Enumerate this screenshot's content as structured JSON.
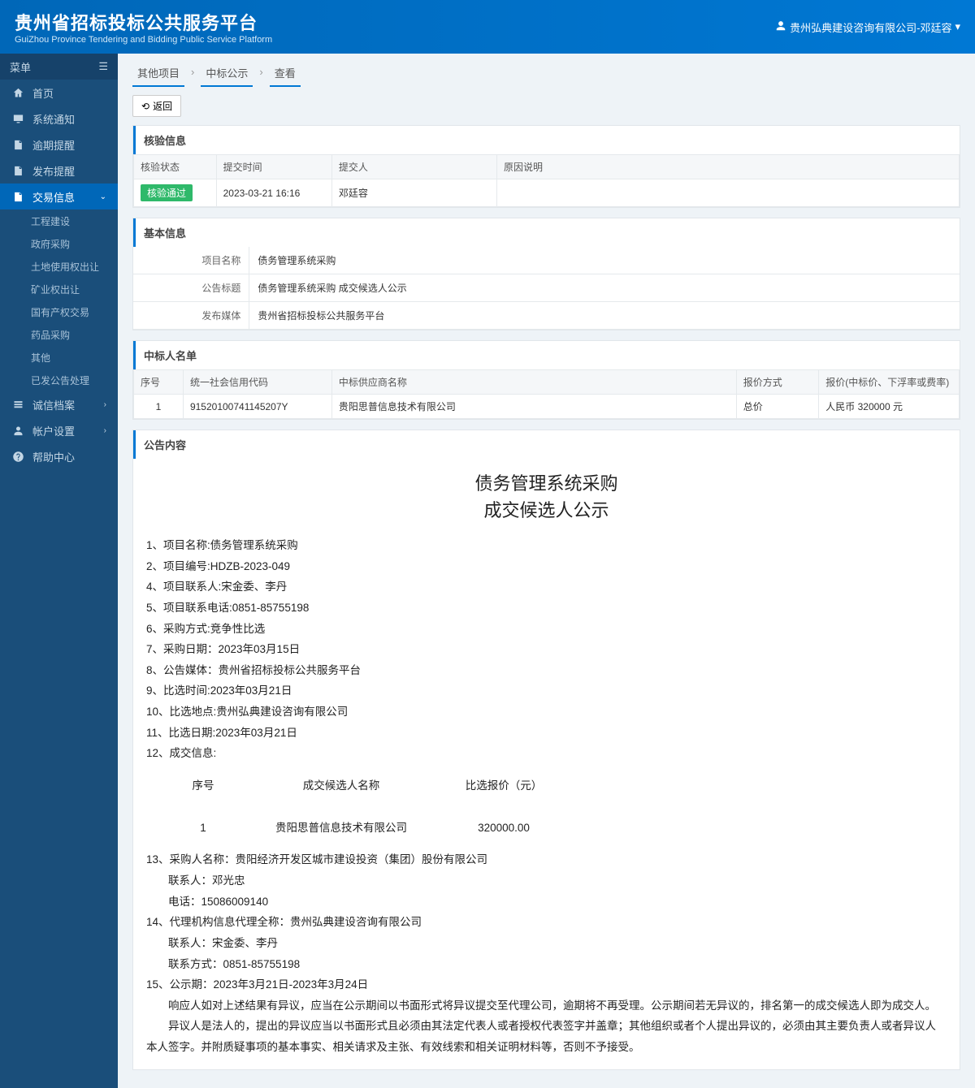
{
  "header": {
    "title_cn": "贵州省招标投标公共服务平台",
    "title_en": "GuiZhou Province Tendering and Bidding Public Service Platform",
    "user": "贵州弘典建设咨询有限公司-邓廷容"
  },
  "sidebar": {
    "menu_label": "菜单",
    "items": [
      {
        "label": "首页",
        "icon": "home"
      },
      {
        "label": "系统通知",
        "icon": "monitor"
      },
      {
        "label": "逾期提醒",
        "icon": "doc"
      },
      {
        "label": "发布提醒",
        "icon": "doc"
      },
      {
        "label": "交易信息",
        "icon": "doc",
        "active": true,
        "expand": true
      },
      {
        "label": "诚信档案",
        "icon": "list",
        "caret": true
      },
      {
        "label": "帐户设置",
        "icon": "user",
        "caret": true
      },
      {
        "label": "帮助中心",
        "icon": "help"
      }
    ],
    "sub_items": [
      "工程建设",
      "政府采购",
      "土地使用权出让",
      "矿业权出让",
      "国有产权交易",
      "药品采购",
      "其他",
      "已发公告处理"
    ]
  },
  "breadcrumb": {
    "a": "其他项目",
    "b": "中标公示",
    "c": "查看"
  },
  "back": "返回",
  "sections": {
    "verify": "核验信息",
    "basic": "基本信息",
    "winner": "中标人名单",
    "notice": "公告内容"
  },
  "verify_table": {
    "headers": [
      "核验状态",
      "提交时间",
      "提交人",
      "原因说明"
    ],
    "status": "核验通过",
    "submit_time": "2023-03-21 16:16",
    "submitter": "邓廷容",
    "reason": ""
  },
  "basic_info": [
    {
      "label": "项目名称",
      "value": "债务管理系统采购"
    },
    {
      "label": "公告标题",
      "value": "债务管理系统采购 成交候选人公示"
    },
    {
      "label": "发布媒体",
      "value": "贵州省招标投标公共服务平台"
    }
  ],
  "winner_table": {
    "headers": [
      "序号",
      "统一社会信用代码",
      "中标供应商名称",
      "报价方式",
      "报价(中标价、下浮率或费率)"
    ],
    "rows": [
      {
        "no": "1",
        "code": "91520100741145207Y",
        "name": "贵阳思普信息技术有限公司",
        "method": "总价",
        "price": "人民币 320000 元"
      }
    ]
  },
  "notice": {
    "title_l1": "债务管理系统采购",
    "title_l2": "成交候选人公示",
    "lines": [
      "1、项目名称:债务管理系统采购",
      "2、项目编号:HDZB-2023-049",
      "4、项目联系人:宋金委、李丹",
      "5、项目联系电话:0851-85755198",
      "6、采购方式:竞争性比选",
      "7、采购日期：2023年03月15日",
      "8、公告媒体：贵州省招标投标公共服务平台",
      "9、比选时间:2023年03月21日",
      "10、比选地点:贵州弘典建设咨询有限公司",
      "11、比选日期:2023年03月21日",
      "12、成交信息:"
    ],
    "candidate_headers": [
      "序号",
      "成交候选人名称",
      "比选报价（元）"
    ],
    "candidates": [
      {
        "no": "1",
        "name": "贵阳思普信息技术有限公司",
        "price": "320000.00"
      }
    ],
    "lines_after": [
      "13、采购人名称：贵阳经济开发区城市建设投资（集团）股份有限公司",
      "　　联系人：邓光忠",
      "　　电话：15086009140",
      "14、代理机构信息代理全称：贵州弘典建设咨询有限公司",
      "　　联系人：宋金委、李丹",
      "　　联系方式：0851-85755198",
      "15、公示期：2023年3月21日-2023年3月24日",
      "　　响应人如对上述结果有异议，应当在公示期间以书面形式将异议提交至代理公司，逾期将不再受理。公示期间若无异议的，排名第一的成交候选人即为成交人。",
      "　　异议人是法人的，提出的异议应当以书面形式且必须由其法定代表人或者授权代表签字并盖章；其他组织或者个人提出异议的，必须由其主要负责人或者异议人本人签字。并附质疑事项的基本事实、相关请求及主张、有效线索和相关证明材料等，否则不予接受。"
    ]
  }
}
